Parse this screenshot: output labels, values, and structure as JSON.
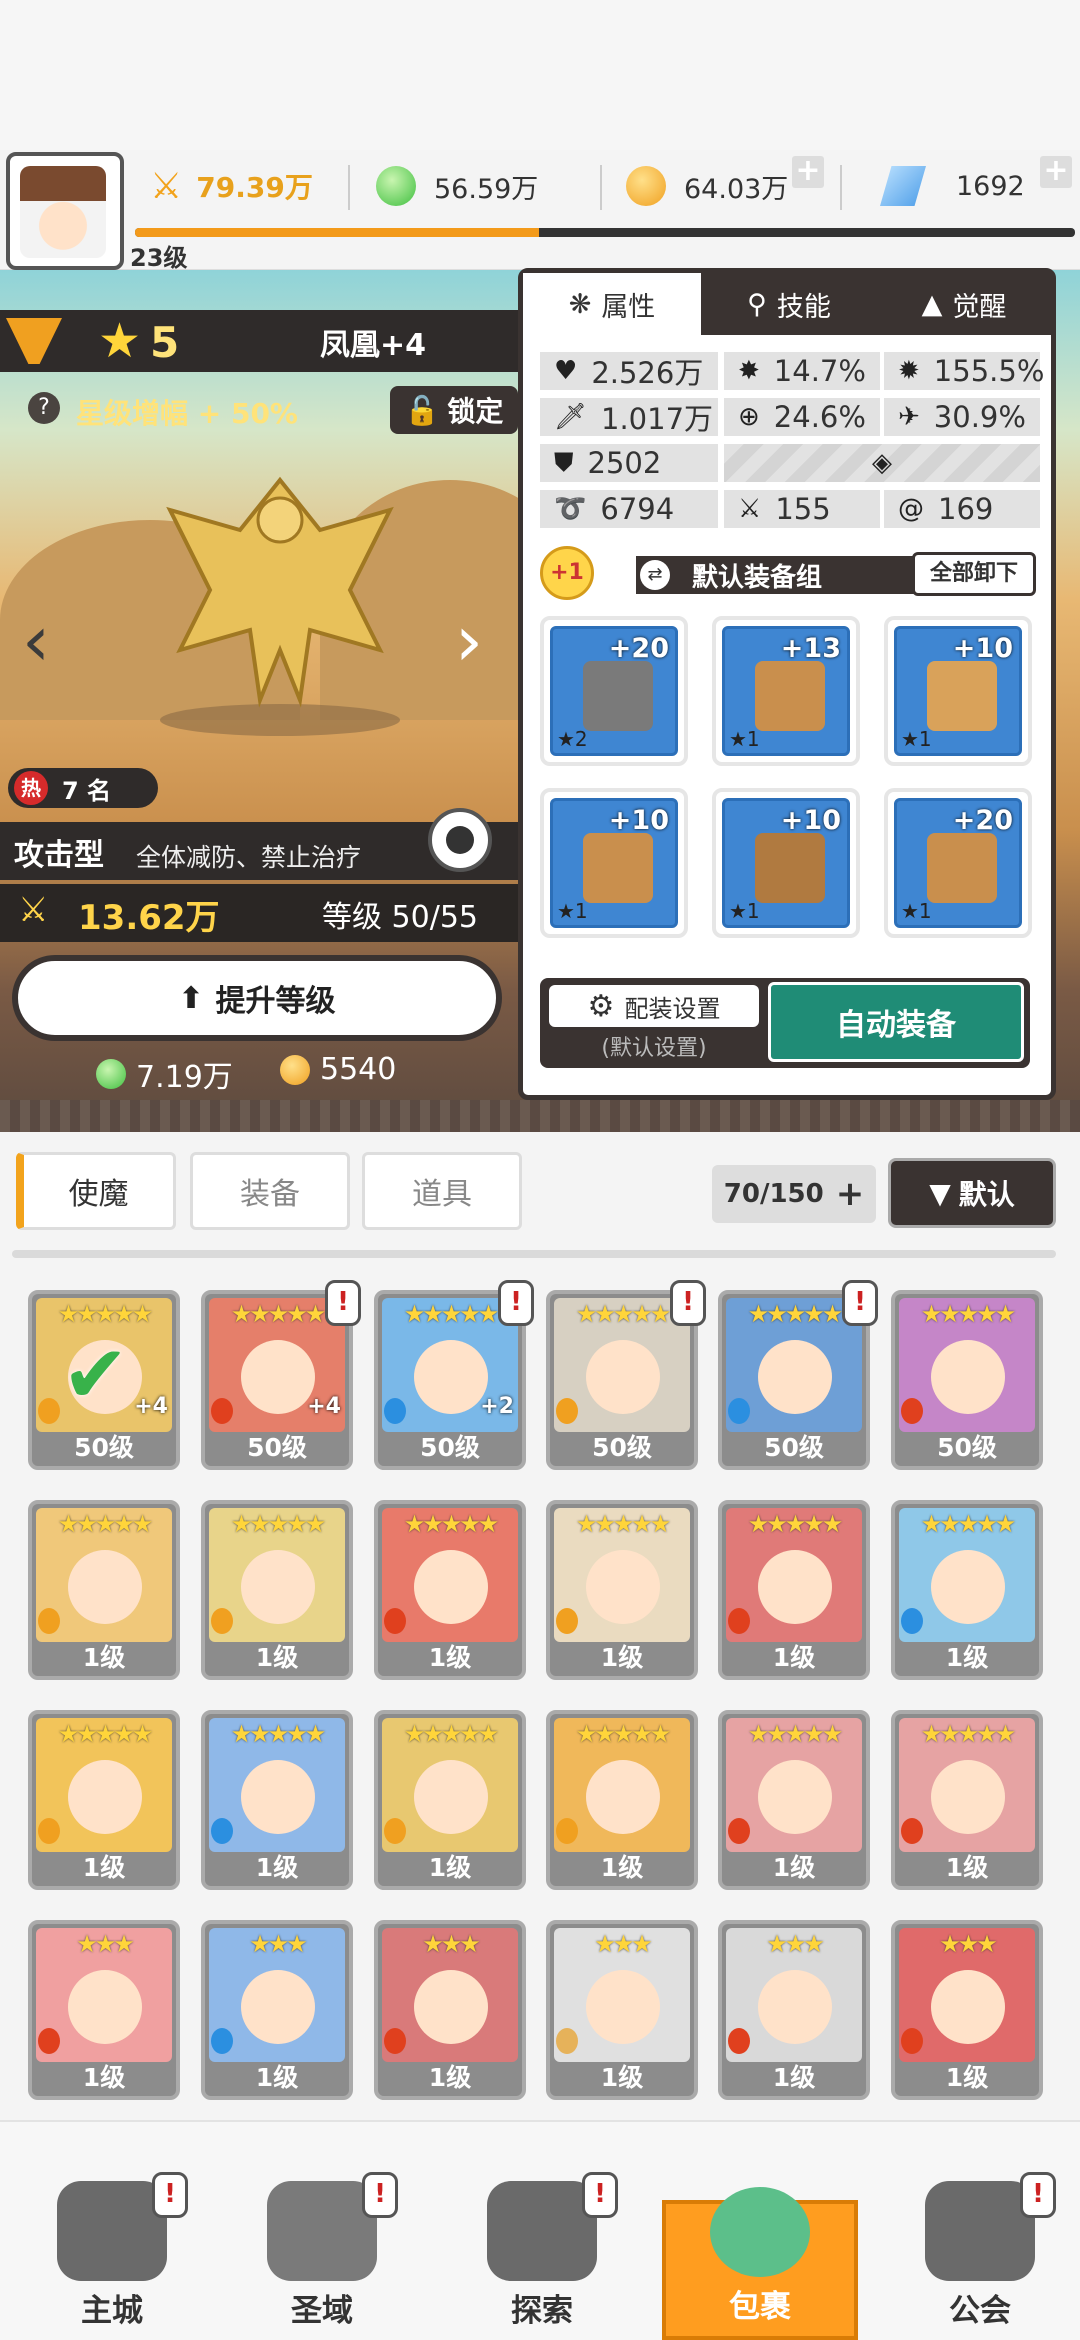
{
  "topbar": {
    "player_level": "23级",
    "power": "79.39万",
    "green_currency": "56.59万",
    "gold_currency": "64.03万",
    "gem_currency": "1692",
    "xp_progress": 0.43
  },
  "hero": {
    "stars": "5",
    "name": "凤凰+4",
    "star_bonus": "星级增幅 + 50%",
    "lock_label": "锁定",
    "hot_rank": "7 名",
    "hot_badge": "热",
    "type": "攻击型",
    "type_desc": "全体减防、禁止治疗",
    "power": "13.62万",
    "level": "等级 50/55",
    "upgrade_label": "提升等级",
    "cost_green": "7.19万",
    "cost_gold": "5540"
  },
  "panel": {
    "tabs": [
      {
        "label": "属性",
        "icon": "attribute-icon"
      },
      {
        "label": "技能",
        "icon": "skill-icon"
      },
      {
        "label": "觉醒",
        "icon": "awaken-icon"
      }
    ],
    "stats": {
      "hp": "2.526万",
      "crit_rate": "14.7%",
      "crit_dmg": "155.5%",
      "atk": "1.017万",
      "accuracy": "24.6%",
      "speed": "30.9%",
      "def": "2502",
      "res": "6794",
      "stat_a": "155",
      "stat_b": "169"
    },
    "equip_bonus": "+1",
    "equip_group": "默认装备组",
    "unequip_all": "全部卸下",
    "slots": [
      {
        "level": "+20",
        "stars": "★2",
        "item": "sword"
      },
      {
        "level": "+13",
        "stars": "★1",
        "item": "helmet"
      },
      {
        "level": "+10",
        "stars": "★1",
        "item": "armor"
      },
      {
        "level": "+10",
        "stars": "★1",
        "item": "belt"
      },
      {
        "level": "+10",
        "stars": "★1",
        "item": "necklace"
      },
      {
        "level": "+20",
        "stars": "★1",
        "item": "boots"
      }
    ],
    "loadout_label": "配装设置",
    "loadout_sub": "(默认设置)",
    "auto_equip": "自动装备"
  },
  "inventory": {
    "tabs": [
      "使魔",
      "装备",
      "道具"
    ],
    "count": "70/150",
    "sort_label": "默认",
    "cards": [
      {
        "stars": "★★★★★",
        "level": "50级",
        "plus": "+4",
        "color": "#e9c46a",
        "elem": "#f0a020",
        "alert": false,
        "check": true
      },
      {
        "stars": "★★★★★",
        "level": "50级",
        "plus": "+4",
        "color": "#e57f6a",
        "elem": "#e0401e",
        "alert": true,
        "check": false
      },
      {
        "stars": "★★★★★",
        "level": "50级",
        "plus": "+2",
        "color": "#7ab8e8",
        "elem": "#2b8fe0",
        "alert": true,
        "check": false
      },
      {
        "stars": "★★★★★",
        "level": "50级",
        "plus": "",
        "color": "#d7d0c2",
        "elem": "#f0a020",
        "alert": true,
        "check": false
      },
      {
        "stars": "★★★★★",
        "level": "50级",
        "plus": "",
        "color": "#6e9fd6",
        "elem": "#2b8fe0",
        "alert": true,
        "check": false
      },
      {
        "stars": "★★★★★",
        "level": "50级",
        "plus": "",
        "color": "#c586c8",
        "elem": "#e0401e",
        "alert": false,
        "check": false
      },
      {
        "stars": "★★★★★",
        "level": "1级",
        "plus": "",
        "color": "#f0c87a",
        "elem": "#f0a020",
        "alert": false,
        "check": false
      },
      {
        "stars": "★★★★★",
        "level": "1级",
        "plus": "",
        "color": "#e8d48a",
        "elem": "#f0a020",
        "alert": false,
        "check": false
      },
      {
        "stars": "★★★★★",
        "level": "1级",
        "plus": "",
        "color": "#e87a6a",
        "elem": "#e0401e",
        "alert": false,
        "check": false
      },
      {
        "stars": "★★★★★",
        "level": "1级",
        "plus": "",
        "color": "#eadbc0",
        "elem": "#f0a020",
        "alert": false,
        "check": false
      },
      {
        "stars": "★★★★★",
        "level": "1级",
        "plus": "",
        "color": "#e07a78",
        "elem": "#e0401e",
        "alert": false,
        "check": false
      },
      {
        "stars": "★★★★★",
        "level": "1级",
        "plus": "",
        "color": "#8fc8e8",
        "elem": "#2b8fe0",
        "alert": false,
        "check": false
      },
      {
        "stars": "★★★★★",
        "level": "1级",
        "plus": "",
        "color": "#f2c45a",
        "elem": "#f0a020",
        "alert": false,
        "check": false
      },
      {
        "stars": "★★★★★",
        "level": "1级",
        "plus": "",
        "color": "#8fb8e8",
        "elem": "#2b8fe0",
        "alert": false,
        "check": false
      },
      {
        "stars": "★★★★★",
        "level": "1级",
        "plus": "",
        "color": "#e8c870",
        "elem": "#f0a020",
        "alert": false,
        "check": false
      },
      {
        "stars": "★★★★★",
        "level": "1级",
        "plus": "",
        "color": "#f0b85a",
        "elem": "#f0a020",
        "alert": false,
        "check": false
      },
      {
        "stars": "★★★★★",
        "level": "1级",
        "plus": "",
        "color": "#e6a3a3",
        "elem": "#e0401e",
        "alert": false,
        "check": false
      },
      {
        "stars": "★★★★★",
        "level": "1级",
        "plus": "",
        "color": "#e6a3a3",
        "elem": "#e0401e",
        "alert": false,
        "check": false
      },
      {
        "stars": "★★★",
        "level": "1级",
        "plus": "",
        "color": "#f0a0a0",
        "elem": "#e0401e",
        "alert": false,
        "check": false
      },
      {
        "stars": "★★★",
        "level": "1级",
        "plus": "",
        "color": "#8fb8e8",
        "elem": "#2b8fe0",
        "alert": false,
        "check": false
      },
      {
        "stars": "★★★",
        "level": "1级",
        "plus": "",
        "color": "#d97a7a",
        "elem": "#e0401e",
        "alert": false,
        "check": false
      },
      {
        "stars": "★★★",
        "level": "1级",
        "plus": "",
        "color": "#e0e0e0",
        "elem": "#e6b25a",
        "alert": false,
        "check": false
      },
      {
        "stars": "★★★",
        "level": "1级",
        "plus": "",
        "color": "#d9d9d9",
        "elem": "#e0401e",
        "alert": false,
        "check": false
      },
      {
        "stars": "★★★",
        "level": "1级",
        "plus": "",
        "color": "#e06a6a",
        "elem": "#e0401e",
        "alert": false,
        "check": false
      }
    ],
    "partial_row_stars": [
      "★★★",
      "★★★",
      "★★★",
      "★★★",
      "★★★",
      "★★★"
    ]
  },
  "nav": [
    {
      "label": "主城",
      "icon": "castle-icon",
      "alert": true,
      "active": false
    },
    {
      "label": "圣域",
      "icon": "vortex-icon",
      "alert": true,
      "active": false
    },
    {
      "label": "探索",
      "icon": "sword-stone-icon",
      "alert": true,
      "active": false
    },
    {
      "label": "包裹",
      "icon": "bag-icon",
      "alert": false,
      "active": true
    },
    {
      "label": "公会",
      "icon": "guild-icon",
      "alert": true,
      "active": false
    }
  ],
  "colors": {
    "accent_orange": "#f39a1a",
    "dark_panel": "#3a3331",
    "auto_green": "#1f8c76",
    "gold_text": "#ffd44a"
  }
}
